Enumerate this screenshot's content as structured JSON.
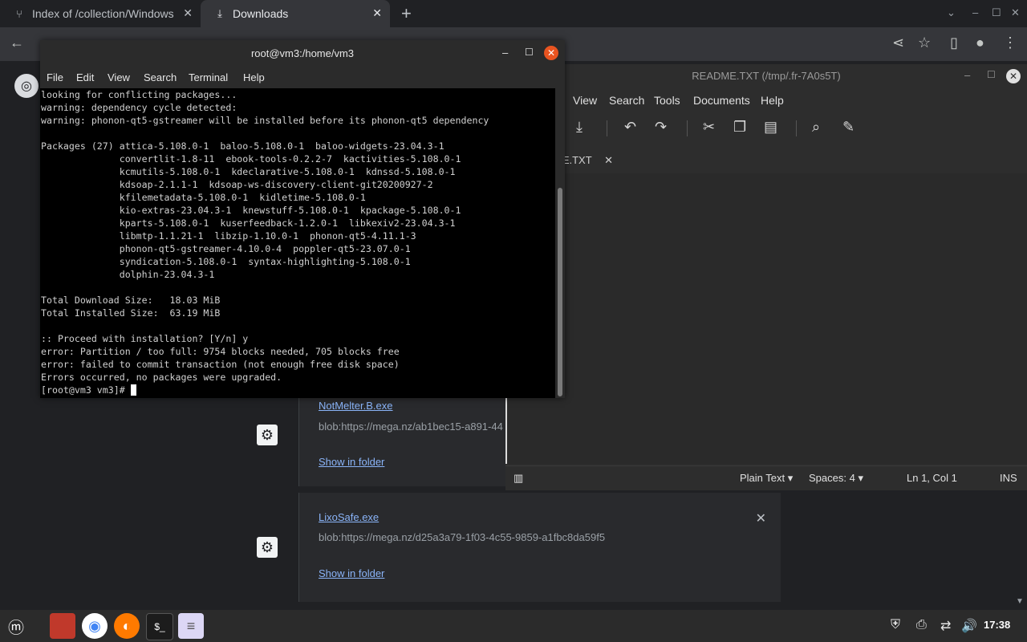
{
  "browser": {
    "tabs": [
      {
        "title": "Index of /collection/Windows",
        "icon": "git-fork-icon"
      },
      {
        "title": "Downloads",
        "icon": "download-icon"
      }
    ],
    "new_tab": "+"
  },
  "downloads": {
    "items": [
      {
        "filename": "NotMelter.B.exe",
        "url": "blob:https://mega.nz/ab1bec15-a891-44",
        "show_in_folder": "Show in folder"
      },
      {
        "filename": "LixoSafe.exe",
        "url": "blob:https://mega.nz/d25a3a79-1f03-4c55-9859-a1fbc8da59f5",
        "show_in_folder": "Show in folder"
      }
    ]
  },
  "gedit": {
    "title": "README.TXT (/tmp/.fr-7A0s5T)",
    "menu": [
      "View",
      "Search",
      "Tools",
      "Documents",
      "Help"
    ],
    "tab_label": "ME.TXT",
    "status": {
      "language": "Plain Text",
      "spaces": "Spaces: 4",
      "position": "Ln 1, Col 1",
      "mode": "INS"
    }
  },
  "terminal": {
    "title": "root@vm3:/home/vm3",
    "menu": [
      "File",
      "Edit",
      "View",
      "Search",
      "Terminal",
      "Help"
    ],
    "lines": [
      "looking for conflicting packages...",
      "warning: dependency cycle detected:",
      "warning: phonon-qt5-gstreamer will be installed before its phonon-qt5 dependency",
      "",
      "Packages (27) attica-5.108.0-1  baloo-5.108.0-1  baloo-widgets-23.04.3-1",
      "              convertlit-1.8-11  ebook-tools-0.2.2-7  kactivities-5.108.0-1",
      "              kcmutils-5.108.0-1  kdeclarative-5.108.0-1  kdnssd-5.108.0-1",
      "              kdsoap-2.1.1-1  kdsoap-ws-discovery-client-git20200927-2",
      "              kfilemetadata-5.108.0-1  kidletime-5.108.0-1",
      "              kio-extras-23.04.3-1  knewstuff-5.108.0-1  kpackage-5.108.0-1",
      "              kparts-5.108.0-1  kuserfeedback-1.2.0-1  libkexiv2-23.04.3-1",
      "              libmtp-1.1.21-1  libzip-1.10.0-1  phonon-qt5-4.11.1-3",
      "              phonon-qt5-gstreamer-4.10.0-4  poppler-qt5-23.07.0-1",
      "              syndication-5.108.0-1  syntax-highlighting-5.108.0-1",
      "              dolphin-23.04.3-1",
      "",
      "Total Download Size:   18.03 MiB",
      "Total Installed Size:  63.19 MiB",
      "",
      ":: Proceed with installation? [Y/n] y",
      "error: Partition / too full: 9754 blocks needed, 705 blocks free",
      "error: failed to commit transaction (not enough free disk space)",
      "Errors occurred, no packages were upgraded."
    ],
    "prompt": "[root@vm3 vm3]# "
  },
  "taskbar": {
    "clock": "17:38"
  },
  "colors": {
    "close_accent": "#e95420",
    "link": "#8ab4f8"
  }
}
